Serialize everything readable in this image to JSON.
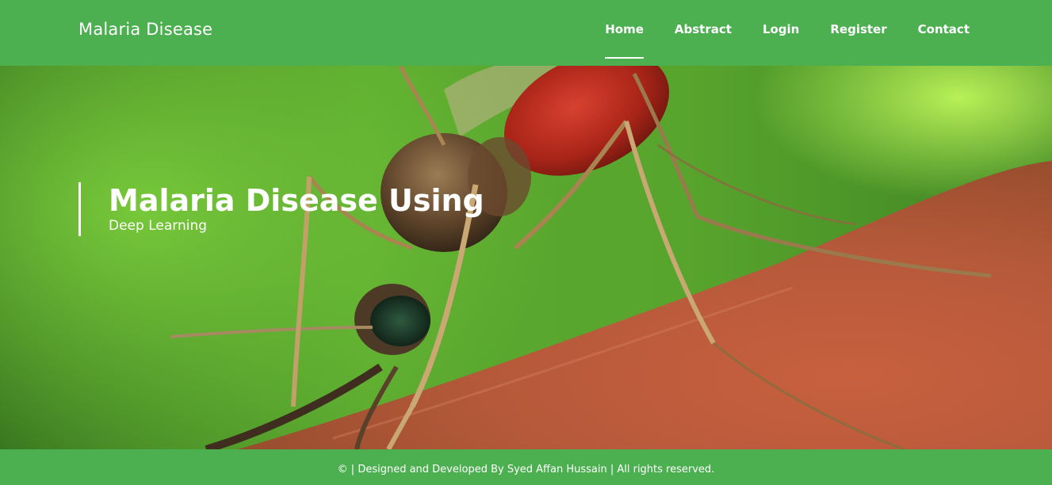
{
  "navbar": {
    "brand": "Malaria Disease",
    "links": [
      {
        "label": "Home",
        "active": true
      },
      {
        "label": "Abstract",
        "active": false
      },
      {
        "label": "Login",
        "active": false
      },
      {
        "label": "Register",
        "active": false
      },
      {
        "label": "Contact",
        "active": false
      }
    ]
  },
  "hero": {
    "title": "Malaria Disease Using",
    "subtitle": "Deep Learning",
    "image": "mosquito-on-skin-photo"
  },
  "footer": {
    "text": "© | Designed and Developed By Syed Affan Hussain | All rights reserved."
  },
  "colors": {
    "primary": "#4caf50",
    "text": "#ffffff"
  }
}
